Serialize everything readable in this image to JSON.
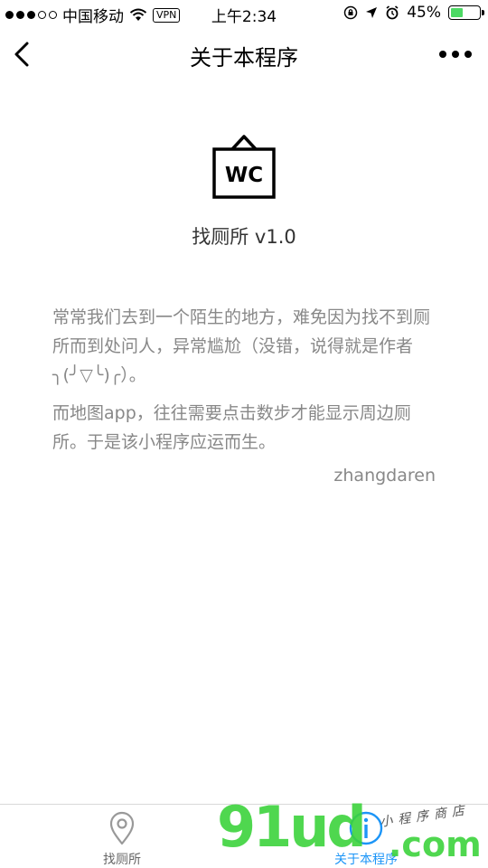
{
  "status_bar": {
    "carrier": "中国移动",
    "vpn": "VPN",
    "time": "上午2:34",
    "battery": "45%",
    "battery_level": 0.45,
    "battery_color": "#4cd964"
  },
  "nav": {
    "title": "关于本程序",
    "back_icon": "chevron-left-icon",
    "more_icon": "more-dots-icon"
  },
  "app": {
    "logo_icon": "wc-sign-icon",
    "logo_text": "WC",
    "title": "找厕所 v1.0"
  },
  "about": {
    "paragraph1": "常常我们去到一个陌生的地方，难免因为找不到厕所而到处问人，异常尴尬（没错，说得就是作者╮(╯▽╰)╭）。",
    "paragraph2": "而地图app，往往需要点击数步才能显示周边厕所。于是该小程序应运而生。",
    "author": "zhangdaren"
  },
  "tab_bar": {
    "tabs": [
      {
        "label": "找厕所",
        "icon": "map-pin-icon",
        "active": false
      },
      {
        "label": "关于本程序",
        "icon": "info-circle-icon",
        "active": true
      }
    ],
    "active_color": "#1c95f7",
    "inactive_color": "#666666"
  },
  "watermark": {
    "digits": "91ud",
    "suffix": ".com",
    "tagline": "小程序商店",
    "color": "#3cd33c"
  }
}
